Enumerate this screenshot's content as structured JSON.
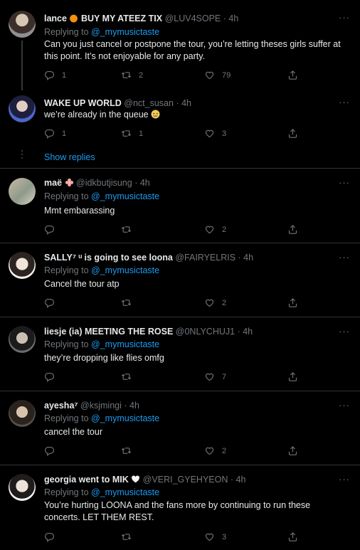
{
  "more_label": "···",
  "show_replies": "Show replies",
  "colors": {
    "background": "#000000",
    "link": "#1d9bf0",
    "muted": "#71767b",
    "text": "#e7e9ea"
  },
  "tweets": [
    {
      "name": "lance",
      "name_suffix": "BUY MY ATEEZ TIX",
      "handle": "@LUV4SOPE",
      "time": "· 4h",
      "replying_prefix": "Replying to",
      "replying_to": "@_mymusictaste",
      "text": "Can you just cancel or postpone the tour, you’re letting theses girls suffer at this point. It’s not enjoyable for any party.",
      "replies": "1",
      "retweets": "2",
      "likes": "79"
    },
    {
      "name": "WAKE UP WORLD",
      "handle": "@nct_susan",
      "time": "· 4h",
      "text": "we’re already in the queue",
      "replies": "1",
      "retweets": "1",
      "likes": "3"
    },
    {
      "name": "maë",
      "handle": "@idkbutjisung",
      "time": "· 4h",
      "replying_prefix": "Replying to",
      "replying_to": "@_mymusictaste",
      "text": "Mmt embarassing",
      "replies": "",
      "retweets": "",
      "likes": "2"
    },
    {
      "name": "SALLY⁷ ᵘ is going to see loona",
      "handle": "@FAIRYELRIS",
      "time": "· 4h",
      "replying_prefix": "Replying to",
      "replying_to": "@_mymusictaste",
      "text": "Cancel the tour atp",
      "replies": "",
      "retweets": "",
      "likes": "2"
    },
    {
      "name": "liesje (ia) MEETING THE ROSE",
      "handle": "@0NLYCHUJ1",
      "time": "· 4h",
      "replying_prefix": "Replying to",
      "replying_to": "@_mymusictaste",
      "text": "they’re dropping like flies omfg",
      "replies": "",
      "retweets": "",
      "likes": "7"
    },
    {
      "name": "ayesha⁷",
      "handle": "@ksjmingi",
      "time": "· 4h",
      "replying_prefix": "Replying to",
      "replying_to": "@_mymusictaste",
      "text": "cancel the tour",
      "replies": "",
      "retweets": "",
      "likes": "2"
    },
    {
      "name": "georgia went to MIK",
      "handle": "@VERI_GYEHYEON",
      "time": "· 4h",
      "replying_prefix": "Replying to",
      "replying_to": "@_mymusictaste",
      "text": "You’re hurting LOONA and the fans more by continuing to run these concerts. LET THEM REST.",
      "replies": "",
      "retweets": "",
      "likes": "3"
    }
  ]
}
